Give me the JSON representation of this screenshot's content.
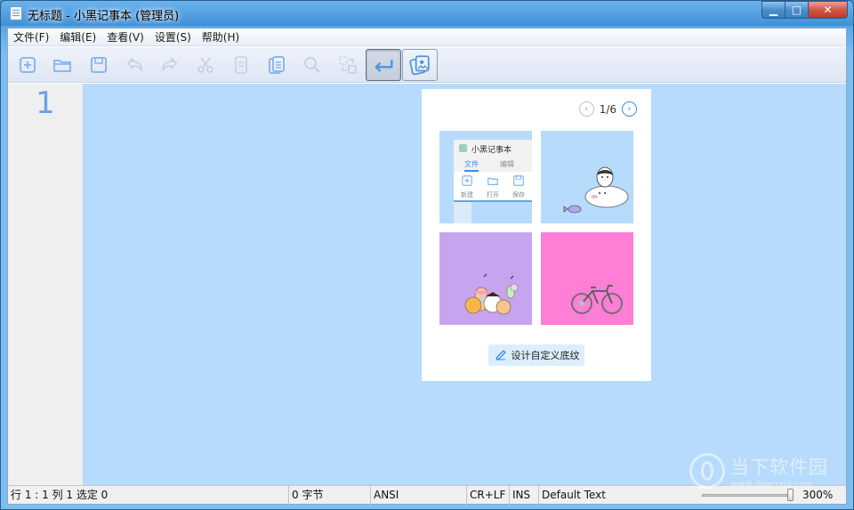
{
  "window": {
    "title": "无标题 - 小黑记事本 (管理员)",
    "controls": {
      "minimize": "▁",
      "maximize": "□",
      "close": "✕"
    }
  },
  "menu": [
    {
      "label": "文件(F)"
    },
    {
      "label": "编辑(E)"
    },
    {
      "label": "查看(V)"
    },
    {
      "label": "设置(S)"
    },
    {
      "label": "帮助(H)"
    }
  ],
  "toolbar": {
    "icons": [
      "new-file-icon",
      "open-folder-icon",
      "save-icon",
      "undo-icon",
      "redo-icon",
      "cut-icon",
      "copy-icon",
      "paste-icon",
      "search-icon",
      "replace-icon",
      "word-wrap-icon",
      "background-theme-icon"
    ],
    "pressed": "word-wrap-icon"
  },
  "editor": {
    "line_number": "1",
    "background": "#b6dbfd"
  },
  "popup": {
    "pager": {
      "text": "1/6",
      "prev": "‹",
      "next": "›"
    },
    "thumbnails": [
      {
        "name": "app-preview",
        "color": "#b6dbfd"
      },
      {
        "name": "penguin-seal",
        "color": "#b6dbfd"
      },
      {
        "name": "macarons",
        "color": "#c6a4ef"
      },
      {
        "name": "bicycle",
        "color": "#ff7fd6"
      }
    ],
    "mini_app": {
      "title": "小黑记事本",
      "tabs": [
        "文件",
        "编辑"
      ],
      "tools": [
        "新建",
        "打开",
        "保存"
      ]
    },
    "design_button": "设计自定义底纹"
  },
  "status": {
    "position": "行 1 : 1    列 1    选定 0",
    "bytes": "0 字节",
    "encoding": "ANSI",
    "line_ending": "CR+LF",
    "mode": "INS",
    "syntax": "Default Text",
    "zoom_percent": 300,
    "zoom_text": "300%"
  },
  "watermark": {
    "cn": "当下软件园",
    "url": "www.downxia.com"
  },
  "colors": {
    "accent": "#3b8fe0",
    "line_number": "#6aa2e6"
  }
}
